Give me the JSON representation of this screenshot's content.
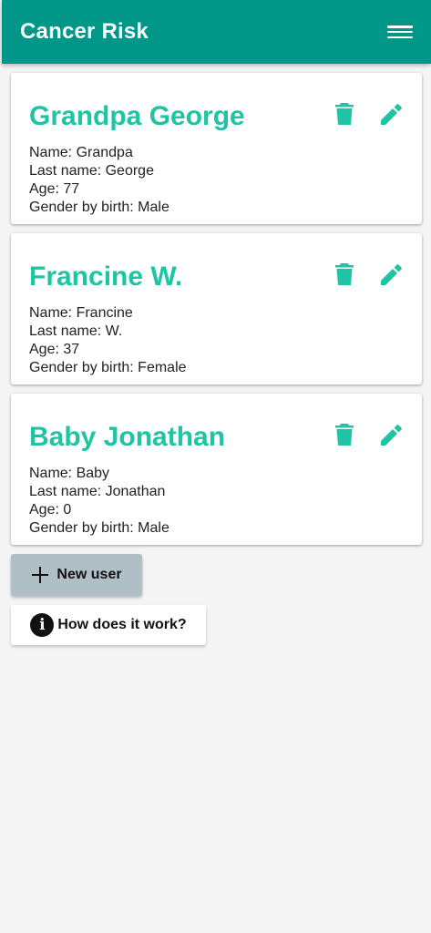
{
  "appbar": {
    "title": "Cancer Risk",
    "menu_icon": "hamburger-menu-icon"
  },
  "colors": {
    "appbar": "#009688",
    "accent": "#1ec4a4",
    "new_user_button": "#b0bec5"
  },
  "users": [
    {
      "title": "Grandpa George",
      "name": "Name: Grandpa",
      "last_name": "Last name: George",
      "age": "Age: 77",
      "gender": "Gender by birth: Male"
    },
    {
      "title": "Francine W.",
      "name": "Name: Francine",
      "last_name": "Last name: W.",
      "age": "Age: 37",
      "gender": "Gender by birth: Female"
    },
    {
      "title": "Baby Jonathan",
      "name": "Name: Baby",
      "last_name": "Last name: Jonathan",
      "age": "Age: 0",
      "gender": "Gender by birth: Male"
    }
  ],
  "actions": {
    "new_user_label": "New user",
    "how_label": "How does it work?"
  }
}
